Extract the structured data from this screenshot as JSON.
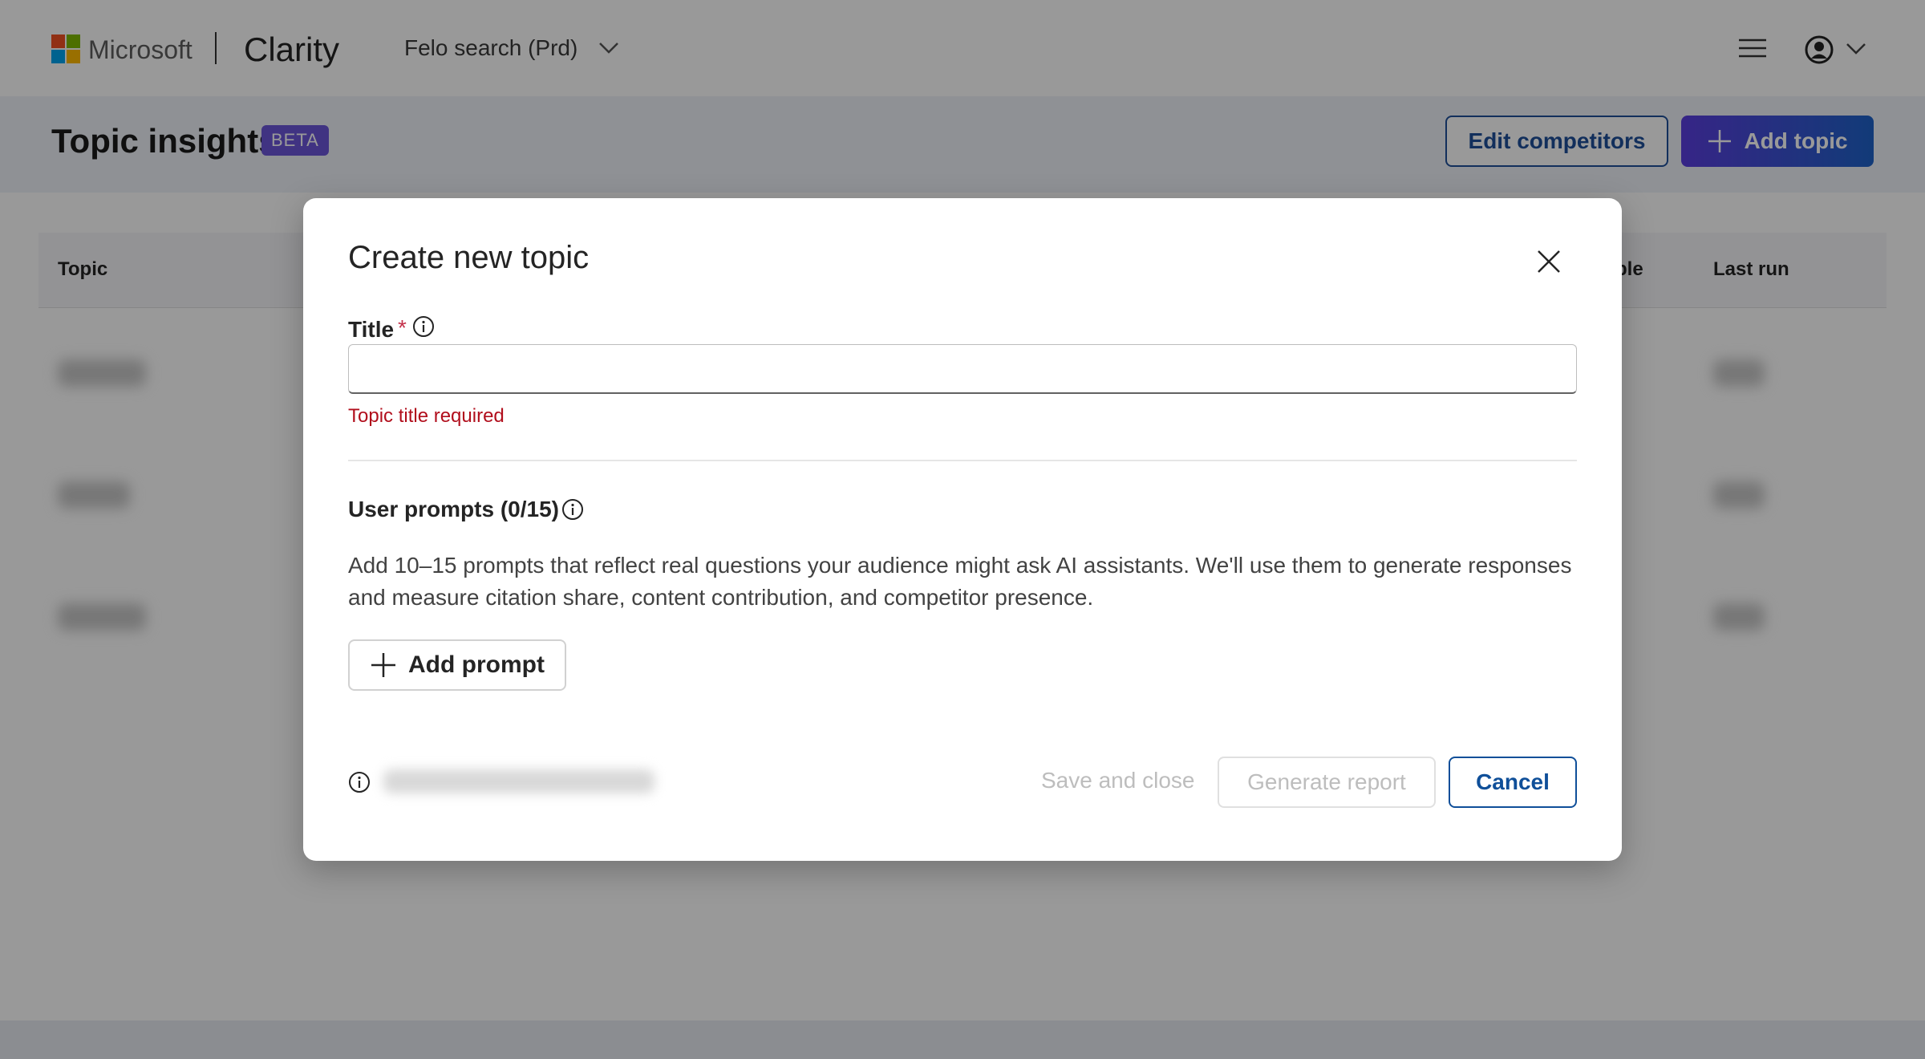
{
  "header": {
    "brand": "Microsoft",
    "product": "Clarity",
    "project": "Felo search (Prd)",
    "icons": [
      "microsoft-logo-icon",
      "chevron-down-icon",
      "hamburger-menu-icon",
      "user-avatar-icon",
      "chevron-down-icon"
    ]
  },
  "page": {
    "title": "Topic insights",
    "badge": "BETA",
    "edit_competitors": "Edit competitors",
    "add_topic": "Add topic"
  },
  "table": {
    "columns": [
      "Topic",
      "ple",
      "Last run"
    ]
  },
  "modal": {
    "title": "Create new topic",
    "title_label": "Title",
    "required_marker": "*",
    "title_value": "",
    "title_error": "Topic title required",
    "prompts_label": "User prompts (0/15)",
    "description": "Add 10–15 prompts that reflect real questions your audience might ask AI assistants. We'll use them to generate responses and measure citation share, content contribution, and competitor presence.",
    "add_prompt": "Add prompt",
    "save_and_close": "Save and close",
    "generate_report": "Generate report",
    "cancel": "Cancel"
  },
  "colors": {
    "primary": "#1e4f99",
    "error": "#b10e1c",
    "beta": "#6b55d9",
    "ms_red": "#f25022",
    "ms_green": "#7fba00",
    "ms_blue": "#00a4ef",
    "ms_yellow": "#ffb900"
  }
}
